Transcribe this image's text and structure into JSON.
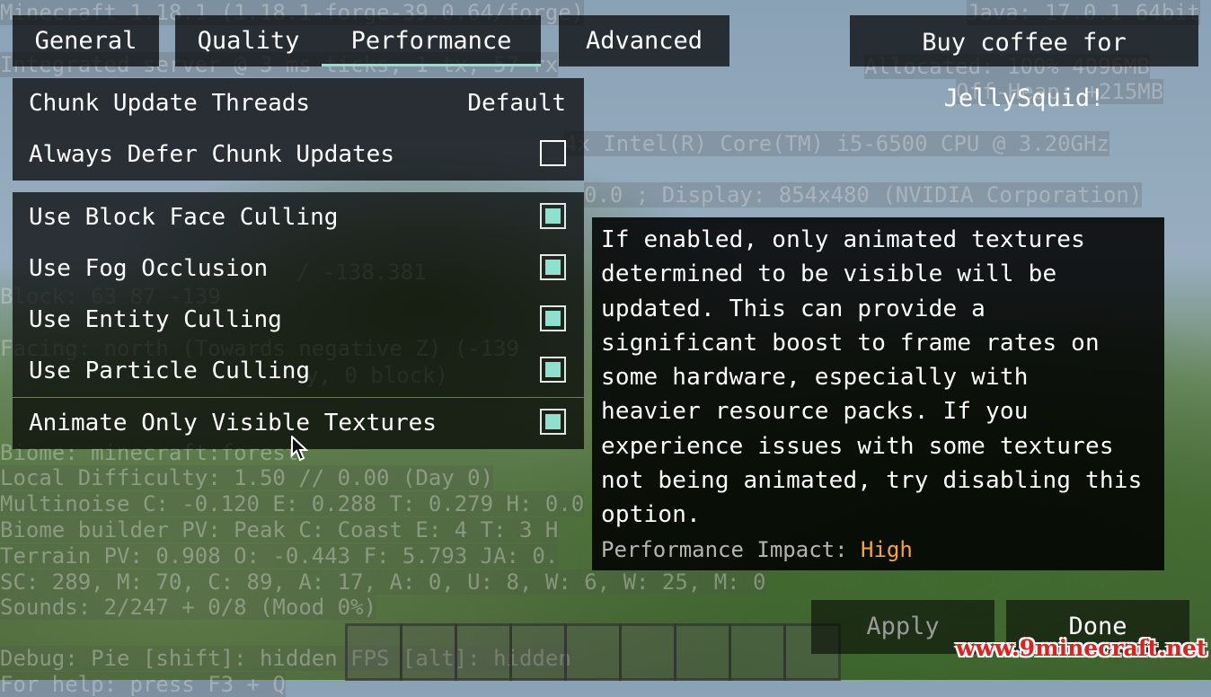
{
  "tabs": [
    {
      "label": "General"
    },
    {
      "label": "Quality"
    },
    {
      "label": "Performance",
      "active": true
    },
    {
      "label": "Advanced"
    }
  ],
  "donate_label": "Buy coffee for JellySquid!",
  "options": [
    {
      "label": "Chunk Update Threads",
      "value": "Default"
    },
    {
      "label": "Always Defer Chunk Updates",
      "checked": false
    },
    {
      "label": "Use Block Face Culling",
      "checked": true
    },
    {
      "label": "Use Fog Occlusion",
      "checked": true
    },
    {
      "label": "Use Entity Culling",
      "checked": true
    },
    {
      "label": "Use Particle Culling",
      "checked": true
    },
    {
      "label": "Animate Only Visible Textures",
      "checked": true
    }
  ],
  "tooltip": {
    "description": "If enabled, only animated textures\ndetermined to be visible will be\nupdated. This can provide a\nsignificant boost to frame rates on\nsome hardware, especially with\nheavier resource packs. If you\nexperience issues with some textures\nnot being animated, try disabling this\noption.",
    "impact_label": "Performance Impact:",
    "impact_value": "High"
  },
  "buttons": {
    "apply": "Apply",
    "done": "Done"
  },
  "watermark": "www.9minecraft.net",
  "debug_overlay": [
    "Minecraft 1.18.1 (1.18.1-forge-39.0.64/forge)",
    "Integrated server @ 3 ms ticks, 1 tx, 57 rx",
    "Java: 17.0.1 64bit",
    "Allocated: 100% 4096MB",
    "Off-Heap: +215MB",
    "4x Intel(R) Core(TM) i5-6500 CPU @ 3.20GHz",
    "0.0 ; Display: 854x480 (NVIDIA Corporation)",
    "/ -138.381",
    "Block: 63 87 -139",
    "Facing: north (Towards negative Z) (-139",
    "y, 0 block)",
    "Biome: minecraft:forest",
    "Local Difficulty: 1.50 // 0.00 (Day 0)",
    "Multinoise C: -0.120 E: 0.288 T: 0.279 H: 0.0",
    "Biome builder PV: Peak C: Coast E: 4 T: 3 H",
    "Terrain PV: 0.908 O: -0.443 F: 5.793 JA: 0.",
    "SC: 289, M: 70, C: 89, A: 17, A: 0, U: 8, W: 6, W: 25, M: 0",
    "Sounds: 2/247 + 0/8 (Mood 0%)",
    "Debug: Pie [shift]: hidden FPS [alt]: hidden",
    "For help: press F3 + Q"
  ]
}
